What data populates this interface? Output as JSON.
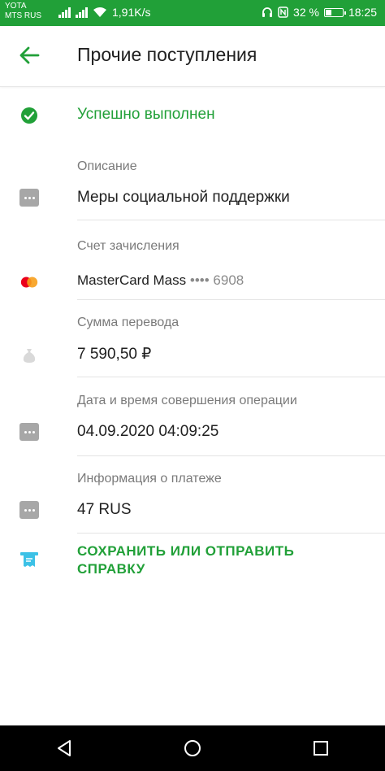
{
  "status_bar": {
    "carrier1": "YOTA",
    "carrier2": "MTS RUS",
    "speed": "1,91K/s",
    "battery_percent": "32 %",
    "time": "18:25",
    "bg_color": "#21a038"
  },
  "header": {
    "back_icon": "arrow-left-icon",
    "title": "Прочие поступления"
  },
  "operation": {
    "status": "Успешно выполнен",
    "status_icon": "check-circle-icon",
    "description_label": "Описание",
    "description_value": "Меры социальной поддержки",
    "account_label": "Счет зачисления",
    "account_name": "MasterCard Mass",
    "account_mask": "•••• 6908",
    "amount_label": "Сумма перевода",
    "amount_value": "7 590,50 ₽",
    "datetime_label": "Дата и время совершения операции",
    "datetime_value": "04.09.2020 04:09:25",
    "payment_info_label": "Информация о платеже",
    "payment_info_value": "47 RUS"
  },
  "actions": {
    "save_send_label": "СОХРАНИТЬ ИЛИ ОТПРАВИТЬ СПРАВКУ",
    "receipt_icon": "receipt-icon"
  },
  "colors": {
    "accent": "#21a038",
    "icon_gray": "#a7a7a7",
    "receipt_icon": "#3cc1e6"
  }
}
